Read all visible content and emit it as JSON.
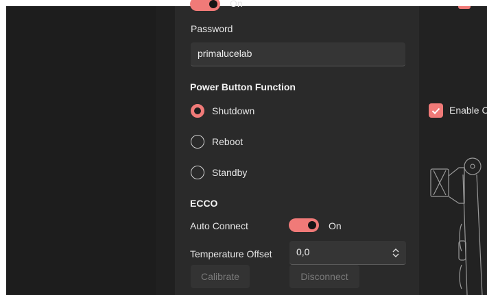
{
  "panel": {
    "top_toggle_state": "On",
    "password_label": "Password",
    "password_value": "primalucelab",
    "power_heading": "Power Button Function",
    "power_options": [
      {
        "label": "Shutdown",
        "checked": true
      },
      {
        "label": "Reboot",
        "checked": false
      },
      {
        "label": "Standby",
        "checked": false
      }
    ],
    "ecco_heading": "ECCO",
    "auto_connect_label": "Auto Connect",
    "auto_connect_state": "On",
    "temp_offset_label": "Temperature Offset",
    "temp_offset_value": "0,0",
    "calibrate_label": "Calibrate",
    "disconnect_label": "Disconnect"
  },
  "right": {
    "enable_label": "Enable C",
    "enable_checked": true
  },
  "colors": {
    "accent": "#f07a78",
    "panel_bg": "#2a2a2a",
    "input_bg": "#353535",
    "page_bg": "#1a1a1a"
  },
  "icons": {
    "spinner": "up-down-chevron-icon",
    "check": "checkmark-icon",
    "device": "telescope-device-outline"
  }
}
